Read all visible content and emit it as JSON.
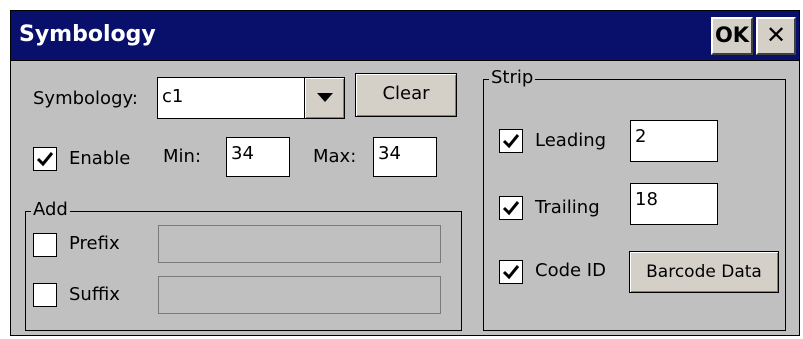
{
  "window": {
    "title": "Symbology",
    "ok_label": "OK",
    "close_label": "✕",
    "title_bar_color": "#08106b",
    "body_color": "#c0c0c0"
  },
  "symbology": {
    "label": "Symbology:",
    "selected": "c1",
    "clear_label": "Clear"
  },
  "enable": {
    "label": "Enable",
    "checked": true,
    "min_label": "Min:",
    "min_value": "34",
    "max_label": "Max:",
    "max_value": "34"
  },
  "add": {
    "title": "Add",
    "prefix_label": "Prefix",
    "prefix_checked": false,
    "prefix_value": "",
    "suffix_label": "Suffix",
    "suffix_checked": false,
    "suffix_value": ""
  },
  "strip": {
    "title": "Strip",
    "leading_label": "Leading",
    "leading_checked": true,
    "leading_value": "2",
    "trailing_label": "Trailing",
    "trailing_checked": true,
    "trailing_value": "18",
    "code_id_label": "Code ID",
    "code_id_checked": true,
    "barcode_data_label": "Barcode Data"
  }
}
